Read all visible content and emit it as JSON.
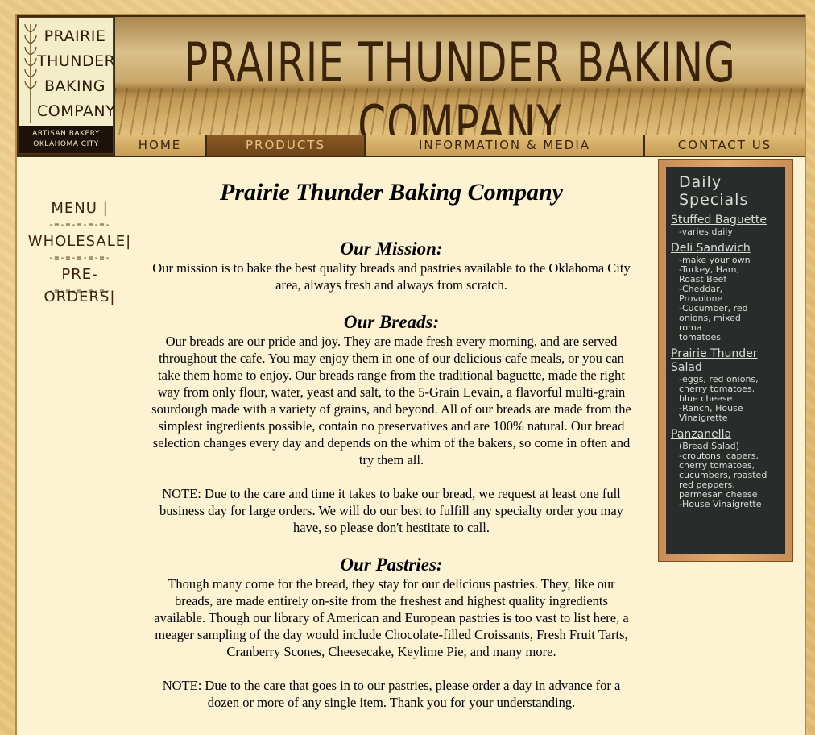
{
  "header": {
    "logo_lines": [
      "PRAIRIE",
      "THUNDER",
      "BAKING",
      "COMPANY"
    ],
    "logo_sub_lines": [
      "ARTISAN BAKERY",
      "OKLAHOMA CITY"
    ],
    "banner_title": "PRAIRIE THUNDER BAKING COMPANY"
  },
  "nav": {
    "items": [
      {
        "label": "HOME"
      },
      {
        "label": "PRODUCTS"
      },
      {
        "label": "INFORMATION & MEDIA"
      },
      {
        "label": "CONTACT US"
      }
    ]
  },
  "sidemenu": {
    "items": [
      {
        "label": "MENU |"
      },
      {
        "label": "WHOLESALE|"
      },
      {
        "label": "PRE-ORDERS|"
      }
    ],
    "separator": "-=-=-=-=-=-"
  },
  "main": {
    "title": "Prairie Thunder Baking Company",
    "mission_heading": "Our Mission:",
    "mission_text": "Our mission is to bake the best quality breads and pastries available to the Oklahoma City area, always fresh and always from scratch.",
    "breads_heading": "Our Breads:",
    "breads_text": "Our breads are our pride and joy. They are made fresh every morning, and are served throughout the cafe. You may enjoy them in one of our delicious cafe meals, or you can take them home to enjoy. Our breads range from the traditional baguette, made the right way from only flour, water, yeast and salt, to the 5-Grain Levain, a flavorful multi-grain sourdough made with a variety of grains, and beyond. All of our breads are made from the simplest ingredients possible, contain no preservatives and are 100% natural. Our bread selection changes every day and depends on the whim of the bakers, so come in often and try them all.",
    "breads_note": "NOTE: Due to the care and time it takes to bake our bread, we request at least one full business day for large orders. We will do our best to fulfill any specialty order you may have, so please don't hestitate to call.",
    "pastries_heading": "Our Pastries:",
    "pastries_text": "Though many come for the bread, they stay for our delicious pastries. They, like our breads, are made entirely on-site from the freshest and highest quality ingredients available. Though our library of American and European pastries is too vast to list here, a meager sampling of the day would include Chocolate-filled Croissants, Fresh Fruit Tarts, Cranberry Scones, Cheesecake, Keylime Pie, and many more.",
    "pastries_note": "NOTE: Due to the care that goes in to our pastries, please order a day in advance for a dozen or more of any single item. Thank you for your understanding."
  },
  "chalkboard": {
    "title_lines": [
      "Daily",
      "Specials"
    ],
    "sections": [
      {
        "head": "Stuffed Baguette",
        "lines": [
          "-varies daily"
        ]
      },
      {
        "head": "Deli Sandwich",
        "lines": [
          "-make your own",
          "-Turkey, Ham,",
          "Roast Beef",
          "-Cheddar,",
          "Provolone",
          "-Cucumber, red",
          "onions, mixed",
          "roma",
          "tomatoes"
        ]
      },
      {
        "head": "Prairie Thunder Salad",
        "lines": [
          "-eggs, red onions,",
          "cherry tomatoes,",
          "blue cheese",
          "-Ranch, House",
          "Vinaigrette"
        ]
      },
      {
        "head": "Panzanella",
        "lines": [
          "(Bread Salad)",
          "-croutons, capers,",
          "cherry tomatoes,",
          "cucumbers, roasted",
          "red peppers,",
          "parmesan cheese",
          "-House Vinaigrette"
        ]
      }
    ]
  },
  "colors": {
    "page_bg": "#e9c57e",
    "content_bg": "#fdf2d2",
    "header_dark": "#3b2a14",
    "chalkboard": "#2a2c2b"
  }
}
